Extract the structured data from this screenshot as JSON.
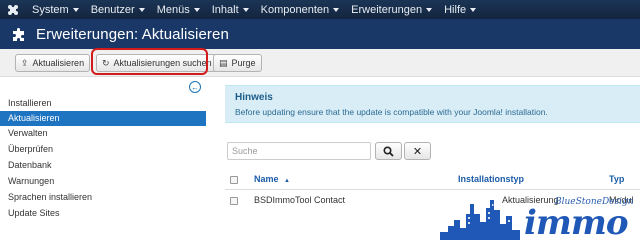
{
  "navbar": {
    "logo_icon": "joomla-logo-icon",
    "menus": [
      "System",
      "Benutzer",
      "Menüs",
      "Inhalt",
      "Komponenten",
      "Erweiterungen",
      "Hilfe"
    ]
  },
  "header": {
    "title": "Erweiterungen: Aktualisieren",
    "icon": "puzzle-icon"
  },
  "toolbar": {
    "update_label": "Aktualisieren",
    "find_updates_label": "Aktualisierungen suchen",
    "purge_label": "Purge",
    "highlight_color": "#d21b1b"
  },
  "sidebar": {
    "items": [
      {
        "label": "Installieren",
        "active": false
      },
      {
        "label": "Aktualisieren",
        "active": true
      },
      {
        "label": "Verwalten",
        "active": false
      },
      {
        "label": "Überprüfen",
        "active": false
      },
      {
        "label": "Datenbank",
        "active": false
      },
      {
        "label": "Warnungen",
        "active": false
      },
      {
        "label": "Sprachen installieren",
        "active": false
      },
      {
        "label": "Update Sites",
        "active": false
      }
    ]
  },
  "notice": {
    "heading": "Hinweis",
    "text": "Before updating ensure that the update is compatible with your Joomla! installation."
  },
  "search": {
    "placeholder": "Suche",
    "search_icon": "search-icon",
    "clear_icon": "clear-icon"
  },
  "table": {
    "columns": [
      "Name",
      "Installationstyp",
      "Typ"
    ],
    "sort_indicator": "▲",
    "rows": [
      {
        "name": "BSDImmoTool Contact",
        "install_type": "Aktualisierung",
        "type": "Modul"
      }
    ]
  },
  "watermark": {
    "brand": "BlueStoneDesign",
    "word": "immo"
  },
  "colors": {
    "accent": "#1f74c2",
    "navbar": "#1b3556",
    "title_bar": "#1a3867",
    "notice_bg": "#d9edf7"
  }
}
